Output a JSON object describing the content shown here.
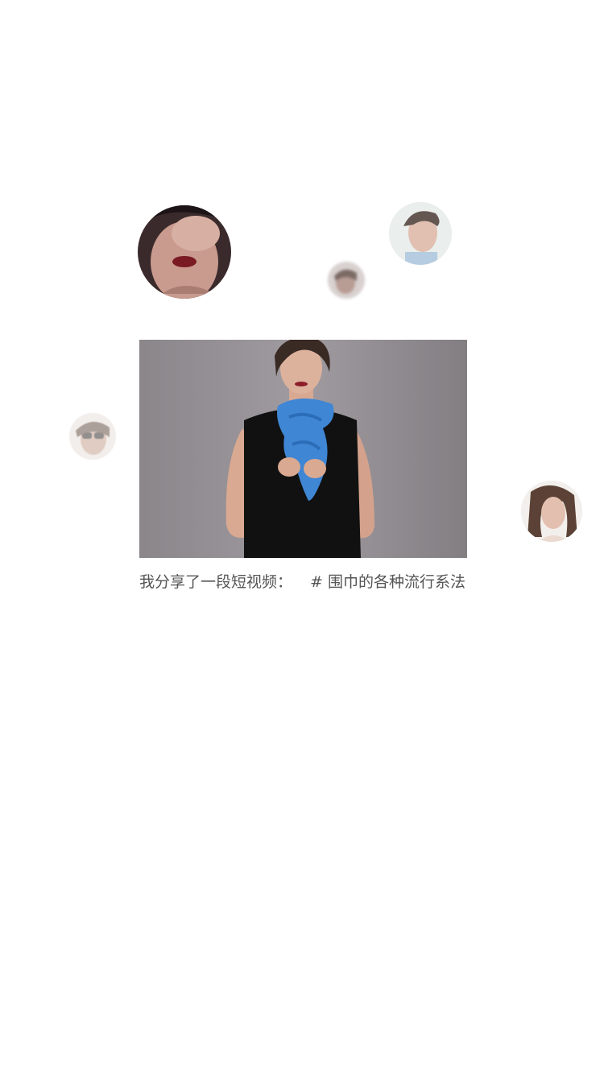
{
  "share": {
    "caption_prefix": "我分享了一段短视频：",
    "hashtag": "# 围巾的各种流行系法"
  },
  "avatars": [
    {
      "name": "avatar-woman-hand-face"
    },
    {
      "name": "avatar-woman-short-hair"
    },
    {
      "name": "avatar-small-blurred"
    },
    {
      "name": "avatar-woman-sunglasses"
    },
    {
      "name": "avatar-woman-long-hair"
    }
  ],
  "colors": {
    "background": "#ffffff",
    "caption_text": "#555555",
    "scarf_blue": "#3f86d4",
    "video_backdrop": "#8f8a8e"
  }
}
